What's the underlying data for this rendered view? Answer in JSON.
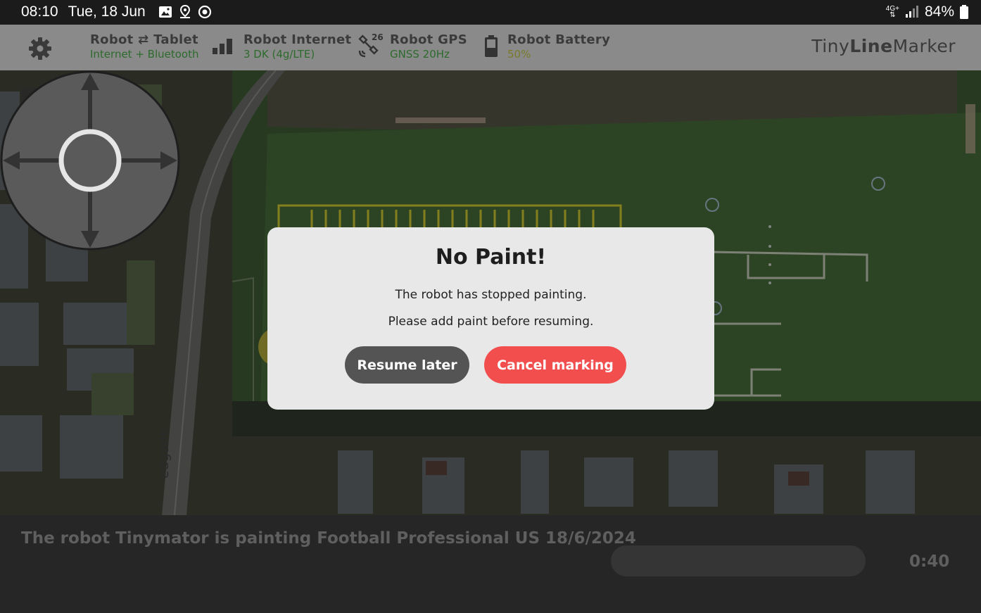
{
  "status_bar": {
    "time": "08:10",
    "date": "Tue, 18 Jun",
    "notification_icons": [
      "gallery-icon",
      "location-icon",
      "sync-icon"
    ],
    "network_label_top": "4G+",
    "network_label_bottom": "R",
    "battery_percent": "84%"
  },
  "header": {
    "settings_icon": "gear-icon",
    "connection": {
      "title_left": "Robot",
      "title_arrow": "⇄",
      "title_right": "Tablet",
      "subtitle": "Internet + Bluetooth",
      "subtitle_color": "#2d6b2d"
    },
    "internet": {
      "title": "Robot Internet",
      "subtitle": "3 DK (4g/LTE)",
      "subtitle_color": "#2d6b2d",
      "icon": "signal-bars-icon"
    },
    "gps": {
      "title": "Robot GPS",
      "subtitle": "GNSS 20Hz",
      "satellites": "26",
      "subtitle_color": "#2d6b2d",
      "icon": "satellite-icon"
    },
    "battery": {
      "title": "Robot Battery",
      "subtitle": "50%",
      "subtitle_color": "#7a7a2a",
      "icon": "battery-icon"
    },
    "brand": {
      "prefix": "Tiny",
      "bold": "Line",
      "suffix": "Marker"
    }
  },
  "map": {
    "tools": [
      "locate-icon",
      "expand-icon",
      "clipboard-icon"
    ],
    "street_label": "edgade",
    "joystick": "joystick-control"
  },
  "modal": {
    "title": "No Paint!",
    "line1": "The robot has stopped painting.",
    "line2": "Please add paint before resuming.",
    "resume_label": "Resume later",
    "cancel_label": "Cancel marking",
    "cancel_color": "#f24e4e",
    "resume_color": "#545454"
  },
  "footer": {
    "message": "The robot Tinymator is painting Football Professional US 18/6/2024",
    "progress": 0.0,
    "timer": "0:40"
  }
}
